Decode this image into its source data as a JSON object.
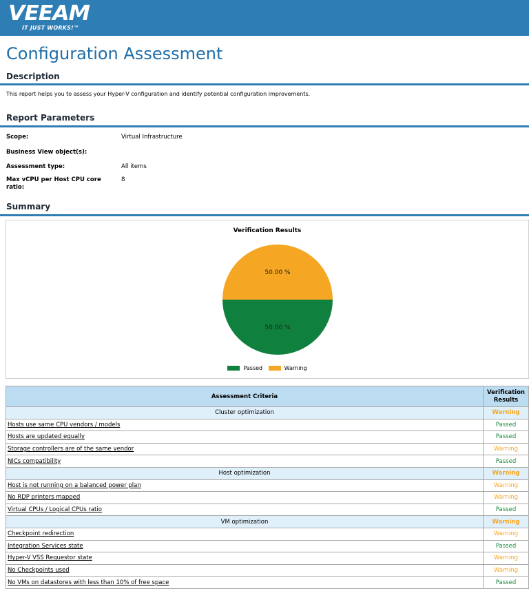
{
  "brand": {
    "logo_text": "VEEAM",
    "tagline": "IT JUST WORKS!™",
    "color": "#2e7db5"
  },
  "page_title": "Configuration Assessment",
  "description": {
    "heading": "Description",
    "text": "This report helps you to assess your Hyper-V configuration and identify potential configuration improvements."
  },
  "parameters": {
    "heading": "Report Parameters",
    "items": [
      {
        "label": "Scope:",
        "value": "Virtual Infrastructure"
      },
      {
        "label": "Business View object(s):",
        "value": ""
      },
      {
        "label": "Assessment type:",
        "value": "All items"
      },
      {
        "label": "Max vCPU per Host CPU core ratio:",
        "value": "8"
      }
    ]
  },
  "summary": {
    "heading": "Summary"
  },
  "chart_data": {
    "type": "pie",
    "title": "Verification Results",
    "categories": [
      "Warning",
      "Passed"
    ],
    "values": [
      50.0,
      50.0
    ],
    "labels": [
      "50.00 %",
      "50.00 %"
    ],
    "colors": [
      "#f5a623",
      "#10803e"
    ],
    "legend": [
      "Passed",
      "Warning"
    ],
    "legend_colors": [
      "#10803e",
      "#f5a623"
    ],
    "legend_position": "bottom"
  },
  "table": {
    "headers": {
      "criteria": "Assessment Criteria",
      "results": "Verification Results"
    },
    "groups": [
      {
        "name": "Cluster optimization",
        "result": "Warning",
        "rows": [
          {
            "criterion": "Hosts use same CPU vendors / models",
            "result": "Passed"
          },
          {
            "criterion": "Hosts are updated equally",
            "result": "Passed"
          },
          {
            "criterion": "Storage controllers are of the same vendor",
            "result": "Warning"
          },
          {
            "criterion": "NICs compatibility",
            "result": "Passed"
          }
        ]
      },
      {
        "name": "Host optimization",
        "result": "Warning",
        "rows": [
          {
            "criterion": "Host is not running on a balanced power plan",
            "result": "Warning"
          },
          {
            "criterion": "No RDP printers mapped",
            "result": "Warning"
          },
          {
            "criterion": "Virtual CPUs / Logical CPUs ratio",
            "result": "Passed"
          }
        ]
      },
      {
        "name": "VM optimization",
        "result": "Warning",
        "rows": [
          {
            "criterion": "Checkpoint redirection",
            "result": "Warning"
          },
          {
            "criterion": "Integration Services state",
            "result": "Passed"
          },
          {
            "criterion": "Hyper-V VSS Requestor state",
            "result": "Warning"
          },
          {
            "criterion": "No Checkpoints used",
            "result": "Warning"
          },
          {
            "criterion": "No VMs on datastores with less than 10% of free space",
            "result": "Passed"
          }
        ]
      }
    ]
  }
}
